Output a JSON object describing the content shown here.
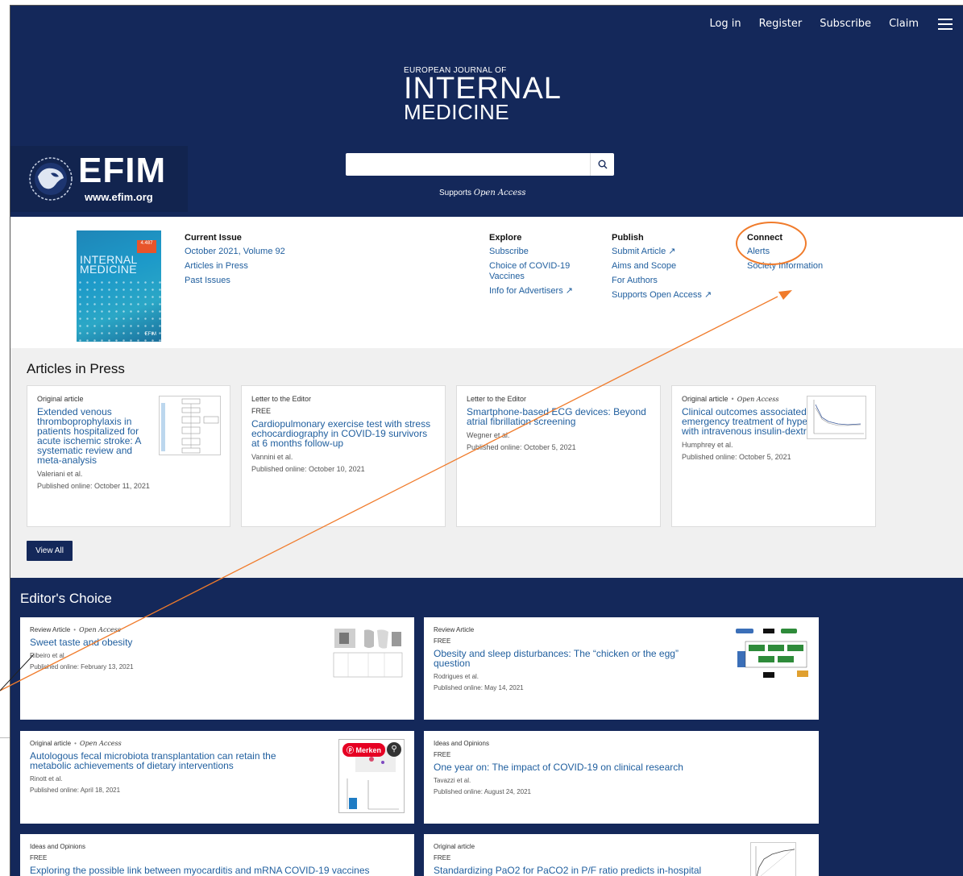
{
  "topnav": {
    "login": "Log in",
    "register": "Register",
    "subscribe": "Subscribe",
    "claim": "Claim"
  },
  "logo": {
    "line1": "EUROPEAN JOURNAL OF",
    "line2": "INTERNAL",
    "line3": "MEDICINE"
  },
  "efim": {
    "name": "EFIM",
    "url": "www.efim.org"
  },
  "search": {
    "placeholder": "",
    "value": ""
  },
  "supports": {
    "prefix": "Supports ",
    "emphasis": "Open Access"
  },
  "cover": {
    "badge": "4.487",
    "title_line1": "INTERNAL",
    "title_line2": "MEDICINE",
    "foot": "EFIM"
  },
  "current_issue": {
    "heading": "Current Issue",
    "links": [
      "October 2021, Volume 92",
      "Articles in Press",
      "Past Issues"
    ]
  },
  "explore": {
    "heading": "Explore",
    "links": [
      "Subscribe",
      "Choice of COVID-19 Vaccines",
      "Info for Advertisers ↗"
    ]
  },
  "publish": {
    "heading": "Publish",
    "links": [
      "Submit Article ↗",
      "Aims and Scope",
      "For Authors",
      "Supports Open Access ↗"
    ]
  },
  "connect": {
    "heading": "Connect",
    "links": [
      "Alerts",
      "Society Information"
    ]
  },
  "articles_in_press": {
    "heading": "Articles in Press",
    "view_all": "View All",
    "cards": [
      {
        "type": "Original article",
        "badge": "",
        "oa": "",
        "title": "Extended venous thromboprophylaxis in patients hospitalized for acute ischemic stroke: A systematic review and meta-analysis",
        "authors": "Valeriani et al.",
        "date": "Published online: October 11, 2021"
      },
      {
        "type": "Letter to the Editor",
        "badge": "FREE",
        "oa": "",
        "title": "Cardiopulmonary exercise test with stress echocardiography in COVID-19 survivors at 6 months follow-up",
        "authors": "Vannini et al.",
        "date": "Published online: October 10, 2021"
      },
      {
        "type": "Letter to the Editor",
        "badge": "",
        "oa": "",
        "title": "Smartphone-based ECG devices: Beyond atrial fibrillation screening",
        "authors": "Wegner et al.",
        "date": "Published online: October 5, 2021"
      },
      {
        "type": "Original article",
        "badge": "",
        "oa": "Open Access",
        "title": "Clinical outcomes associated with the emergency treatment of hyperkalaemia with intravenous insulin-dextrose",
        "authors": "Humphrey et al.",
        "date": "Published online: October 5, 2021"
      }
    ]
  },
  "editors_choice": {
    "heading": "Editor's Choice",
    "cards": [
      {
        "type": "Review Article",
        "badge": "",
        "oa": "Open Access",
        "title": "Sweet taste and obesity",
        "authors": "Ribeiro et al.",
        "date": "Published online: February 13, 2021"
      },
      {
        "type": "Review Article",
        "badge": "FREE",
        "oa": "",
        "title": "Obesity and sleep disturbances: The “chicken or the egg” question",
        "authors": "Rodrigues et al.",
        "date": "Published online: May 14, 2021"
      },
      {
        "type": "Original article",
        "badge": "",
        "oa": "Open Access",
        "title": "Autologous fecal microbiota transplantation can retain the metabolic achievements of dietary interventions",
        "authors": "Rinott et al.",
        "date": "Published online: April 18, 2021",
        "overlay": "Merken"
      },
      {
        "type": "Ideas and Opinions",
        "badge": "FREE",
        "oa": "",
        "title": "One year on: The impact of COVID-19 on clinical research",
        "authors": "Tavazzi et al.",
        "date": "Published online: August 24, 2021"
      },
      {
        "type": "Ideas and Opinions",
        "badge": "FREE",
        "oa": "",
        "title": "Exploring the possible link between myocarditis and mRNA COVID-19 vaccines",
        "authors": "",
        "date": ""
      },
      {
        "type": "Original article",
        "badge": "FREE",
        "oa": "",
        "title": "Standardizing PaO2 for PaCO2 in P/F ratio predicts in-hospital",
        "authors": "",
        "date": ""
      }
    ]
  },
  "colors": {
    "header_bg": "#14285a",
    "link": "#1f5e9e",
    "annotation": "#f07b2b",
    "pinterest": "#e60023"
  }
}
